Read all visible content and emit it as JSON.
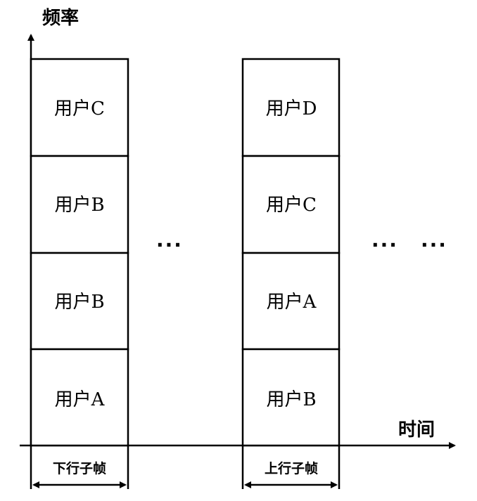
{
  "axes": {
    "y_label": "频率",
    "x_label": "时间"
  },
  "downlink": {
    "label": "下行子帧",
    "cells": [
      "用户C",
      "用户B",
      "用户B",
      "用户A"
    ]
  },
  "uplink": {
    "label": "上行子帧",
    "cells": [
      "用户D",
      "用户C",
      "用户A",
      "用户B"
    ]
  },
  "ellipsis": {
    "middle": "···",
    "right_1": "···",
    "right_2": "···"
  }
}
